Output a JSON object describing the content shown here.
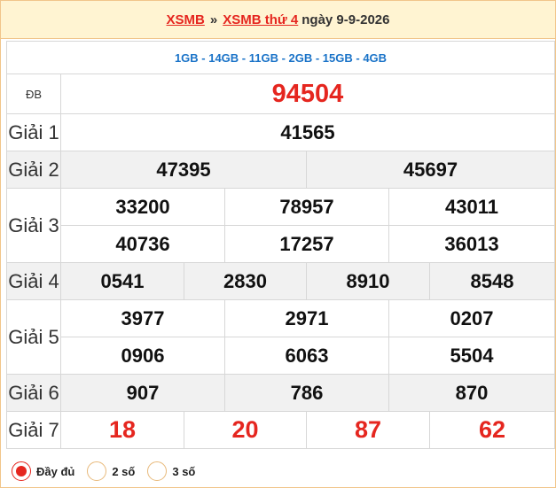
{
  "header": {
    "link1": "XSMB",
    "separator": "»",
    "link2": "XSMB thứ 4",
    "date": "ngày 9-9-2026"
  },
  "codes": "1GB - 14GB - 11GB - 2GB - 15GB - 4GB",
  "prizes": {
    "db": {
      "label": "ĐB",
      "numbers": [
        "94504"
      ]
    },
    "g1": {
      "label": "Giải 1",
      "numbers": [
        "41565"
      ]
    },
    "g2": {
      "label": "Giải 2",
      "numbers": [
        "47395",
        "45697"
      ]
    },
    "g3": {
      "label": "Giải 3",
      "numbers": [
        "33200",
        "78957",
        "43011",
        "40736",
        "17257",
        "36013"
      ]
    },
    "g4": {
      "label": "Giải 4",
      "numbers": [
        "0541",
        "2830",
        "8910",
        "8548"
      ]
    },
    "g5": {
      "label": "Giải 5",
      "numbers": [
        "3977",
        "2971",
        "0207",
        "0906",
        "6063",
        "5504"
      ]
    },
    "g6": {
      "label": "Giải 6",
      "numbers": [
        "907",
        "786",
        "870"
      ]
    },
    "g7": {
      "label": "Giải 7",
      "numbers": [
        "18",
        "20",
        "87",
        "62"
      ]
    }
  },
  "options": [
    {
      "label": "Đầy đủ",
      "selected": true
    },
    {
      "label": "2 số",
      "selected": false
    },
    {
      "label": "3 số",
      "selected": false
    }
  ],
  "colors": {
    "accent_red": "#e5261f",
    "code_blue": "#1a73c8",
    "header_bg": "#fff4d2",
    "border": "#f1c58a"
  }
}
